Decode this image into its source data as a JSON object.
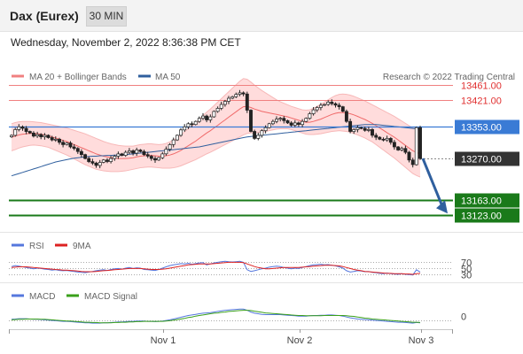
{
  "header": {
    "instrument": "Dax (Eurex)",
    "timeframe": "30 MIN",
    "datetime": "Wednesday, November 2, 2022 8:36:38 PM CET",
    "copyright": "Research © 2022 Trading Central"
  },
  "colors": {
    "resistance": "#f08080",
    "pivot": "#3a7bd5",
    "support": "#1a7a1a",
    "last_price": "#333333",
    "forecast_arrow": "#2f5f9e",
    "bollinger_fill": "#ffd6d6",
    "ma20": "#f06a6a",
    "ma50": "#2f5f9e",
    "candle_up": "#ffffff",
    "candle_down": "#222222",
    "rsi": "#5577dd",
    "rsi_ma": "#dd2222",
    "macd": "#5577dd",
    "macd_signal": "#3aa01a"
  },
  "chart_data": [
    {
      "type": "candlestick",
      "panel": "price",
      "legend": [
        {
          "label": "MA 20 + Bollinger Bands",
          "color": "#f08080"
        },
        {
          "label": "MA 50",
          "color": "#2f5f9e"
        }
      ],
      "ylim": [
        13080,
        13520
      ],
      "x_ticks": [
        "Nov 1",
        "Nov 2",
        "Nov 3"
      ],
      "levels": [
        {
          "role": "resistance",
          "value": 13461.0,
          "label": "13461.00"
        },
        {
          "role": "resistance",
          "value": 13421.0,
          "label": "13421.00"
        },
        {
          "role": "pivot",
          "value": 13353.0,
          "label": "13353.00"
        },
        {
          "role": "last",
          "value": 13270.0,
          "label": "13270.00"
        },
        {
          "role": "support",
          "value": 13163.0,
          "label": "13163.00"
        },
        {
          "role": "support",
          "value": 13123.0,
          "label": "13123.00"
        }
      ],
      "close": [
        13330,
        13345,
        13352,
        13348,
        13340,
        13336,
        13328,
        13332,
        13326,
        13330,
        13324,
        13318,
        13320,
        13312,
        13306,
        13310,
        13300,
        13296,
        13288,
        13280,
        13270,
        13262,
        13258,
        13252,
        13260,
        13266,
        13262,
        13270,
        13276,
        13282,
        13278,
        13286,
        13290,
        13284,
        13292,
        13288,
        13280,
        13276,
        13270,
        13266,
        13272,
        13282,
        13294,
        13306,
        13318,
        13330,
        13344,
        13352,
        13360,
        13358,
        13366,
        13374,
        13380,
        13370,
        13378,
        13392,
        13400,
        13410,
        13418,
        13426,
        13430,
        13436,
        13440,
        13437,
        13395,
        13340,
        13322,
        13330,
        13342,
        13350,
        13360,
        13366,
        13372,
        13374,
        13368,
        13362,
        13356,
        13362,
        13358,
        13366,
        13374,
        13386,
        13396,
        13402,
        13408,
        13410,
        13416,
        13412,
        13408,
        13404,
        13392,
        13366,
        13340,
        13345,
        13350,
        13348,
        13343,
        13345,
        13330,
        13325,
        13320,
        13318,
        13322,
        13312,
        13300,
        13292,
        13296,
        13286,
        13266,
        13254,
        13350,
        13270
      ],
      "volatility": 6,
      "ma20": [
        13325,
        13328,
        13331,
        13333,
        13334,
        13335,
        13335,
        13334,
        13333,
        13331,
        13329,
        13326,
        13323,
        13320,
        13317,
        13314,
        13310,
        13306,
        13302,
        13298,
        13294,
        13290,
        13286,
        13282,
        13279,
        13276,
        13274,
        13272,
        13271,
        13270,
        13270,
        13270,
        13271,
        13272,
        13274,
        13276,
        13277,
        13278,
        13278,
        13277,
        13276,
        13276,
        13277,
        13279,
        13282,
        13286,
        13291,
        13297,
        13303,
        13309,
        13315,
        13322,
        13329,
        13336,
        13342,
        13349,
        13356,
        13363,
        13370,
        13377,
        13384,
        13391,
        13398,
        13404,
        13405,
        13402,
        13398,
        13395,
        13392,
        13390,
        13388,
        13386,
        13384,
        13382,
        13380,
        13378,
        13375,
        13372,
        13369,
        13366,
        13364,
        13364,
        13366,
        13369,
        13372,
        13376,
        13380,
        13384,
        13387,
        13389,
        13389,
        13388,
        13386,
        13383,
        13379,
        13375,
        13371,
        13366,
        13361,
        13355,
        13349,
        13343,
        13337,
        13331,
        13325,
        13318,
        13311,
        13304,
        13297,
        13290,
        13286,
        13282
      ],
      "bb_width": [
        35,
        35,
        34,
        33,
        32,
        31,
        30,
        30,
        30,
        30,
        30,
        31,
        32,
        33,
        34,
        35,
        36,
        37,
        38,
        39,
        40,
        40,
        40,
        40,
        39,
        38,
        37,
        36,
        35,
        34,
        33,
        32,
        31,
        30,
        30,
        30,
        30,
        30,
        30,
        30,
        30,
        31,
        32,
        34,
        36,
        38,
        40,
        42,
        44,
        46,
        48,
        50,
        52,
        54,
        56,
        58,
        60,
        62,
        64,
        66,
        68,
        70,
        72,
        73,
        70,
        66,
        62,
        58,
        54,
        50,
        46,
        42,
        38,
        35,
        33,
        31,
        30,
        30,
        30,
        30,
        31,
        32,
        34,
        36,
        38,
        40,
        42,
        44,
        46,
        47,
        48,
        48,
        48,
        48,
        48,
        48,
        48,
        48,
        48,
        49,
        50,
        51,
        52,
        53,
        54,
        55,
        56,
        57,
        58,
        59,
        60,
        60
      ],
      "ma50": [
        13225,
        13228,
        13231,
        13234,
        13237,
        13240,
        13243,
        13246,
        13249,
        13252,
        13255,
        13258,
        13261,
        13263,
        13265,
        13267,
        13269,
        13271,
        13272,
        13273,
        13274,
        13275,
        13276,
        13276,
        13277,
        13277,
        13278,
        13278,
        13279,
        13279,
        13280,
        13280,
        13281,
        13282,
        13283,
        13284,
        13285,
        13286,
        13287,
        13288,
        13289,
        13290,
        13291,
        13292,
        13293,
        13294,
        13295,
        13296,
        13297,
        13298,
        13299,
        13300,
        13302,
        13304,
        13306,
        13308,
        13310,
        13312,
        13314,
        13316,
        13318,
        13320,
        13322,
        13324,
        13326,
        13327,
        13328,
        13329,
        13330,
        13331,
        13332,
        13333,
        13334,
        13335,
        13336,
        13337,
        13338,
        13339,
        13340,
        13341,
        13342,
        13343,
        13344,
        13345,
        13346,
        13347,
        13348,
        13349,
        13350,
        13351,
        13352,
        13353,
        13354,
        13355,
        13356,
        13357,
        13358,
        13358,
        13358,
        13358,
        13357,
        13356,
        13355,
        13354,
        13353,
        13352,
        13351,
        13350,
        13349,
        13348,
        13347,
        13346
      ]
    },
    {
      "type": "line",
      "panel": "rsi",
      "legend": [
        {
          "label": "RSI",
          "color": "#5577dd"
        },
        {
          "label": "9MA",
          "color": "#dd2222"
        }
      ],
      "levels": [
        70,
        50,
        30
      ],
      "ylim": [
        20,
        80
      ],
      "series": [
        {
          "name": "RSI",
          "values": [
            55,
            58,
            56,
            54,
            52,
            50,
            48,
            50,
            49,
            47,
            46,
            44,
            45,
            43,
            42,
            43,
            41,
            40,
            38,
            37,
            36,
            38,
            40,
            42,
            44,
            45,
            43,
            46,
            48,
            49,
            47,
            50,
            52,
            49,
            51,
            50,
            46,
            45,
            44,
            43,
            46,
            50,
            54,
            58,
            60,
            62,
            64,
            63,
            65,
            62,
            64,
            66,
            67,
            60,
            63,
            66,
            68,
            70,
            71,
            70,
            69,
            70,
            71,
            68,
            45,
            40,
            42,
            45,
            48,
            50,
            53,
            55,
            56,
            55,
            52,
            50,
            48,
            50,
            49,
            52,
            55,
            58,
            60,
            61,
            62,
            60,
            61,
            59,
            57,
            54,
            50,
            42,
            38,
            40,
            42,
            41,
            39,
            40,
            37,
            36,
            34,
            33,
            35,
            33,
            32,
            31,
            33,
            31,
            30,
            29,
            45,
            38
          ]
        },
        {
          "name": "9MA",
          "values": [
            52,
            53,
            54,
            54,
            54,
            53,
            52,
            51,
            50,
            49,
            48,
            47,
            46,
            45,
            44,
            44,
            43,
            42,
            41,
            40,
            39,
            39,
            39,
            40,
            41,
            42,
            43,
            44,
            45,
            46,
            47,
            48,
            49,
            49,
            49,
            49,
            48,
            47,
            46,
            46,
            46,
            47,
            48,
            50,
            52,
            54,
            56,
            58,
            60,
            61,
            62,
            63,
            63,
            63,
            63,
            64,
            65,
            66,
            67,
            68,
            68,
            68,
            68,
            67,
            63,
            59,
            55,
            52,
            50,
            48,
            48,
            49,
            50,
            51,
            52,
            52,
            52,
            52,
            52,
            53,
            54,
            55,
            56,
            57,
            58,
            59,
            59,
            59,
            58,
            57,
            55,
            52,
            49,
            46,
            44,
            42,
            40,
            39,
            38,
            37,
            36,
            35,
            34,
            34,
            33,
            33,
            33,
            32,
            32,
            31,
            33,
            34
          ]
        }
      ]
    },
    {
      "type": "line",
      "panel": "macd",
      "legend": [
        {
          "label": "MACD",
          "color": "#5577dd"
        },
        {
          "label": "MACD Signal",
          "color": "#3aa01a"
        }
      ],
      "levels": [
        0
      ],
      "ylim": [
        -20,
        50
      ],
      "series": [
        {
          "name": "MACD",
          "values": [
            5,
            6,
            7,
            7,
            7,
            6,
            5,
            5,
            4,
            3,
            2,
            1,
            0,
            -1,
            -2,
            -2,
            -3,
            -4,
            -5,
            -6,
            -7,
            -7,
            -8,
            -8,
            -8,
            -7,
            -7,
            -6,
            -5,
            -4,
            -4,
            -3,
            -2,
            -2,
            -1,
            -1,
            -1,
            -2,
            -2,
            -3,
            -2,
            -1,
            1,
            3,
            6,
            9,
            12,
            15,
            18,
            20,
            22,
            24,
            26,
            27,
            28,
            30,
            32,
            34,
            36,
            37,
            38,
            39,
            40,
            40,
            36,
            30,
            26,
            24,
            22,
            21,
            21,
            21,
            21,
            21,
            20,
            19,
            18,
            17,
            16,
            16,
            16,
            17,
            18,
            18,
            19,
            19,
            20,
            20,
            19,
            18,
            16,
            13,
            10,
            8,
            6,
            5,
            4,
            3,
            2,
            1,
            0,
            -1,
            -2,
            -3,
            -4,
            -5,
            -5,
            -6,
            -7,
            -8,
            -6,
            -7
          ]
        },
        {
          "name": "MACD Signal",
          "values": [
            3,
            4,
            5,
            5,
            6,
            6,
            6,
            6,
            5,
            5,
            4,
            3,
            2,
            1,
            0,
            -1,
            -1,
            -2,
            -3,
            -4,
            -5,
            -5,
            -6,
            -6,
            -7,
            -7,
            -7,
            -7,
            -6,
            -6,
            -5,
            -5,
            -4,
            -4,
            -3,
            -3,
            -2,
            -2,
            -2,
            -2,
            -2,
            -2,
            -1,
            0,
            2,
            4,
            6,
            8,
            11,
            13,
            16,
            18,
            20,
            22,
            24,
            26,
            27,
            29,
            30,
            32,
            33,
            34,
            35,
            36,
            36,
            35,
            33,
            31,
            29,
            27,
            26,
            25,
            24,
            23,
            22,
            21,
            20,
            19,
            18,
            18,
            17,
            17,
            17,
            17,
            17,
            18,
            18,
            18,
            18,
            18,
            18,
            17,
            16,
            15,
            13,
            11,
            9,
            8,
            6,
            5,
            4,
            3,
            2,
            1,
            0,
            -1,
            -2,
            -3,
            -4,
            -5,
            -5,
            -6
          ]
        }
      ]
    }
  ]
}
